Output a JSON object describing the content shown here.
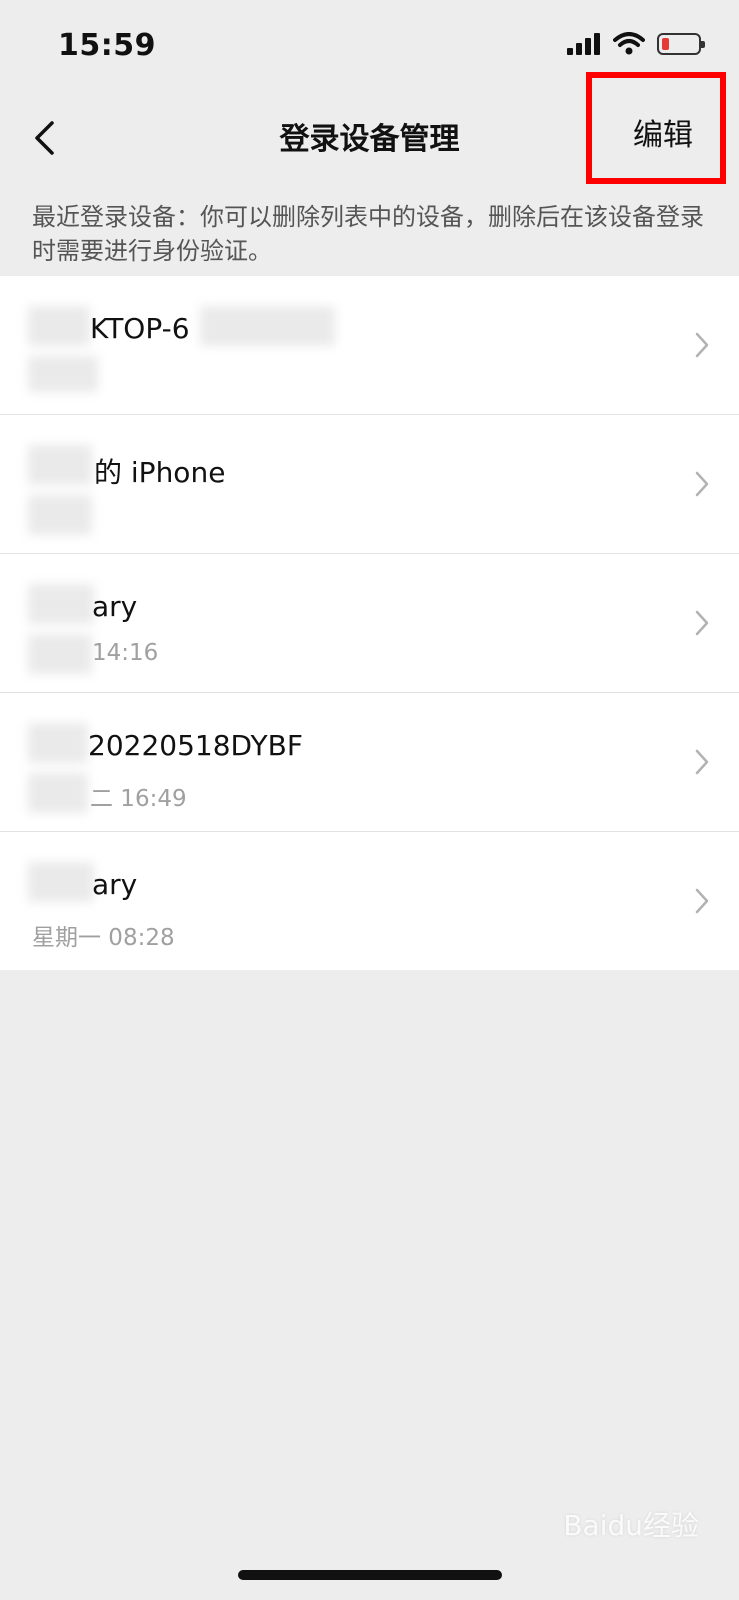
{
  "status_bar": {
    "time": "15:59",
    "battery_level": 0.2
  },
  "nav": {
    "title": "登录设备管理",
    "edit_label": "编辑"
  },
  "description": "最近登录设备：你可以删除列表中的设备，删除后在该设备登录时需要进行身份验证。",
  "devices": [
    {
      "name": "KTOP-6",
      "time": ""
    },
    {
      "name": "的 iPhone",
      "time": ""
    },
    {
      "name": "ary",
      "time": "14:16"
    },
    {
      "name": "20220518DYBF",
      "time": "二 16:49"
    },
    {
      "name": "ary",
      "time": "星期一 08:28"
    }
  ],
  "watermark": "Baidu经验"
}
